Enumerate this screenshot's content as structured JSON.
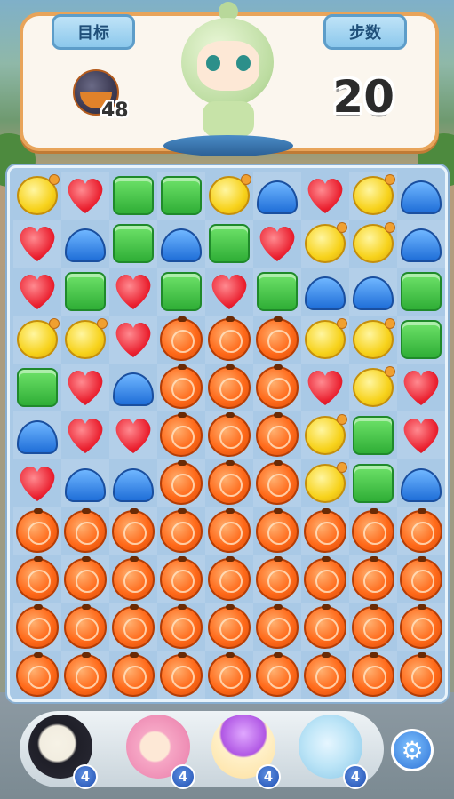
{
  "hud": {
    "goal_label": "目标",
    "moves_label": "步数",
    "goal_count": "48",
    "moves_remaining": "20",
    "goal_icon": "bomb-pot-icon"
  },
  "board": {
    "rows": 11,
    "cols": 9,
    "tiles": [
      [
        "yellow",
        "red",
        "green",
        "green",
        "yellow",
        "blue",
        "red",
        "yellow",
        "blue"
      ],
      [
        "red",
        "blue",
        "green",
        "blue",
        "green",
        "red",
        "yellow",
        "yellow",
        "blue"
      ],
      [
        "red",
        "green",
        "red",
        "green",
        "red",
        "green",
        "blue",
        "blue",
        "green"
      ],
      [
        "yellow",
        "yellow",
        "red",
        "orange",
        "orange",
        "orange",
        "yellow",
        "yellow",
        "green"
      ],
      [
        "green",
        "red",
        "blue",
        "orange",
        "orange",
        "orange",
        "red",
        "yellow",
        "red"
      ],
      [
        "blue",
        "red",
        "red",
        "orange",
        "orange",
        "orange",
        "yellow",
        "green",
        "red"
      ],
      [
        "red",
        "blue",
        "blue",
        "orange",
        "orange",
        "orange",
        "yellow",
        "green",
        "blue"
      ],
      [
        "orange",
        "orange",
        "orange",
        "orange",
        "orange",
        "orange",
        "orange",
        "orange",
        "orange"
      ],
      [
        "orange",
        "orange",
        "orange",
        "orange",
        "orange",
        "orange",
        "orange",
        "orange",
        "orange"
      ],
      [
        "orange",
        "orange",
        "orange",
        "orange",
        "orange",
        "orange",
        "orange",
        "orange",
        "orange"
      ],
      [
        "orange",
        "orange",
        "orange",
        "orange",
        "orange",
        "orange",
        "orange",
        "orange",
        "orange"
      ]
    ]
  },
  "boosters": [
    {
      "name": "panda-booster",
      "count": "4"
    },
    {
      "name": "pink-girl-booster",
      "count": "4"
    },
    {
      "name": "purple-hair-booster",
      "count": "4"
    },
    {
      "name": "blue-bubble-booster",
      "count": "4"
    }
  ],
  "settings_icon": "gear-icon"
}
